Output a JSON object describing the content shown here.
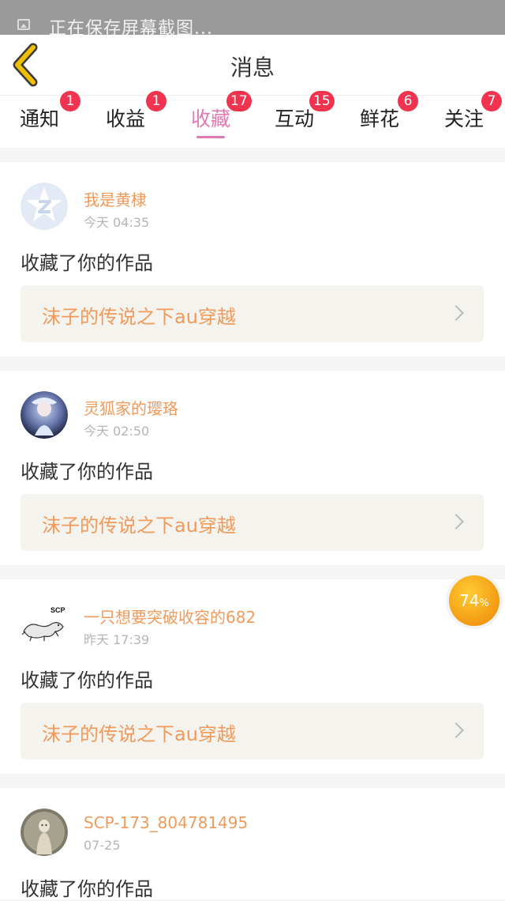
{
  "status_bar": {
    "text": "正在保存屏幕截图..."
  },
  "header": {
    "title": "消息"
  },
  "tabs": [
    {
      "label": "通知",
      "badge": "1",
      "active": false
    },
    {
      "label": "收益",
      "badge": "1",
      "active": false
    },
    {
      "label": "收藏",
      "badge": "17",
      "active": true
    },
    {
      "label": "互动",
      "badge": "15",
      "active": false
    },
    {
      "label": "鲜花",
      "badge": "6",
      "active": false
    },
    {
      "label": "关注",
      "badge": "7",
      "active": false
    }
  ],
  "messages": [
    {
      "username": "我是黄棣",
      "time": "今天 04:35",
      "action": "收藏了你的作品",
      "work_title": "沫子的传说之下au穿越",
      "avatar": "default-z-avatar"
    },
    {
      "username": "灵狐家的璎珞",
      "time": "今天 02:50",
      "action": "收藏了你的作品",
      "work_title": "沫子的传说之下au穿越",
      "avatar": "anime-avatar"
    },
    {
      "username": "一只想要突破收容的682",
      "time": "昨天 17:39",
      "action": "收藏了你的作品",
      "work_title": "沫子的传说之下au穿越",
      "avatar": "scp-lizard-avatar"
    },
    {
      "username": "SCP-173_804781495",
      "time": "07-25",
      "action": "收藏了你的作品",
      "work_title": "",
      "avatar": "scp-173-avatar"
    }
  ],
  "progress": {
    "value": "74",
    "unit": "%"
  },
  "colors": {
    "accent": "#e07ab0",
    "username": "#f09a5b",
    "badge": "#f0334f",
    "back_arrow": "#f0c000"
  }
}
